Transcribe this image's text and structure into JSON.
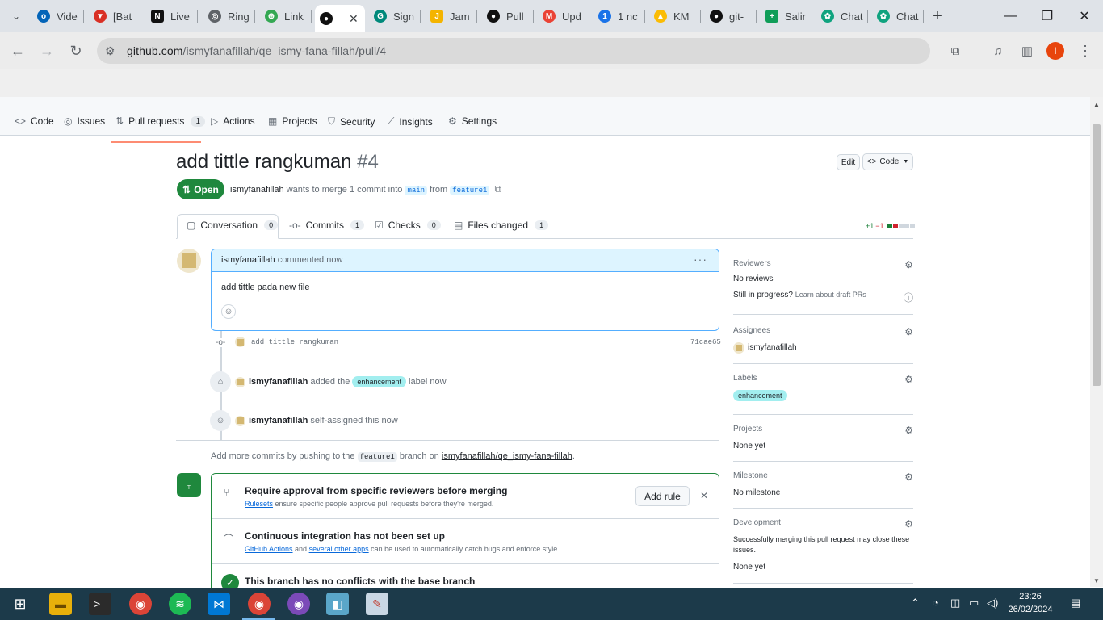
{
  "browser": {
    "tabs": [
      {
        "label": "Vide",
        "icon": "onedrive-icon",
        "color": "#0364b8"
      },
      {
        "label": "[Bat",
        "icon": "pin-icon",
        "color": "#d93025"
      },
      {
        "label": "Live",
        "icon": "notion-icon",
        "color": "#111111"
      },
      {
        "label": "Ring",
        "icon": "ring-icon",
        "color": "#5f6368"
      },
      {
        "label": "Link",
        "icon": "link-icon",
        "color": "#34a853"
      },
      {
        "label": "",
        "icon": "github-icon",
        "color": "#111111"
      },
      {
        "label": "Sign",
        "icon": "signin-icon",
        "color": "#00897b"
      },
      {
        "label": "Jam",
        "icon": "jam-icon",
        "color": "#f4b400"
      },
      {
        "label": "Pull",
        "icon": "github-icon",
        "color": "#111111"
      },
      {
        "label": "Upd",
        "icon": "gmail-icon",
        "color": "#ea4335"
      },
      {
        "label": "1 nc",
        "icon": "badge-icon",
        "color": "#1a73e8"
      },
      {
        "label": "KM",
        "icon": "drive-icon",
        "color": "#fbbc04"
      },
      {
        "label": "git-",
        "icon": "github-icon",
        "color": "#111111"
      },
      {
        "label": "Salir",
        "icon": "sheets-icon",
        "color": "#0f9d58"
      },
      {
        "label": "Chat",
        "icon": "chatgpt-icon",
        "color": "#10a37f"
      },
      {
        "label": "Chat",
        "icon": "chatgpt-icon",
        "color": "#10a37f"
      }
    ],
    "url_host": "github.com",
    "url_path": "/ismyfanafillah/qe_ismy-fana-fillah/pull/4",
    "profile_initial": "I"
  },
  "repo_nav": {
    "code": "Code",
    "issues": "Issues",
    "pulls": "Pull requests",
    "pulls_count": "1",
    "actions": "Actions",
    "projects": "Projects",
    "security": "Security",
    "insights": "Insights",
    "settings": "Settings"
  },
  "pr": {
    "title": "add tittle rangkuman",
    "number": "#4",
    "edit_label": "Edit",
    "code_label": "Code",
    "state": "Open",
    "author": "ismyfanafillah",
    "merge_text": "wants to merge 1 commit into",
    "base": "main",
    "from_text": "from",
    "head": "feature1"
  },
  "pr_tabs": {
    "conversation": "Conversation",
    "conversation_count": "0",
    "commits": "Commits",
    "commits_count": "1",
    "checks": "Checks",
    "checks_count": "0",
    "files": "Files changed",
    "files_count": "1",
    "diff_add": "+1",
    "diff_del": "−1"
  },
  "comment": {
    "author": "ismyfanafillah",
    "meta": "commented now",
    "body": "add tittle pada new file"
  },
  "timeline": {
    "commit_msg": "add tittle rangkuman",
    "commit_sha": "71cae65",
    "label_actor": "ismyfanafillah",
    "label_added": "added the",
    "label_name": "enhancement",
    "label_suffix": "label now",
    "assign_actor": "ismyfanafillah",
    "assign_text": "self-assigned this now"
  },
  "push_hint": {
    "prefix": "Add more commits by pushing to the",
    "branch": "feature1",
    "mid": "branch on",
    "repo": "ismyfanafillah/qe_ismy-fana-fillah",
    "suffix": "."
  },
  "merge": {
    "row1_title": "Require approval from specific reviewers before merging",
    "row1_link": "Rulesets",
    "row1_text": "ensure specific people approve pull requests before they're merged.",
    "add_rule": "Add rule",
    "row2_title": "Continuous integration has not been set up",
    "row2_link1": "GitHub Actions",
    "row2_and": "and",
    "row2_link2": "several other apps",
    "row2_text": "can be used to automatically catch bugs and enforce style.",
    "row3_title": "This branch has no conflicts with the base branch"
  },
  "sidebar": {
    "reviewers_h": "Reviewers",
    "reviewers_v": "No reviews",
    "draft_q": "Still in progress?",
    "draft_link": "Learn about draft PRs",
    "assignees_h": "Assignees",
    "assignee": "ismyfanafillah",
    "labels_h": "Labels",
    "label": "enhancement",
    "projects_h": "Projects",
    "projects_v": "None yet",
    "milestone_h": "Milestone",
    "milestone_v": "No milestone",
    "dev_h": "Development",
    "dev_text1": "Successfully merging this pull request may close these",
    "dev_text2": "issues.",
    "dev_v": "None yet"
  },
  "taskbar": {
    "time": "23:26",
    "date": "26/02/2024"
  },
  "colors": {
    "accent_green": "#1f883d",
    "link_blue": "#0969da",
    "label_enhancement": "#a2eeef",
    "tab_underline": "#fd8c73"
  }
}
